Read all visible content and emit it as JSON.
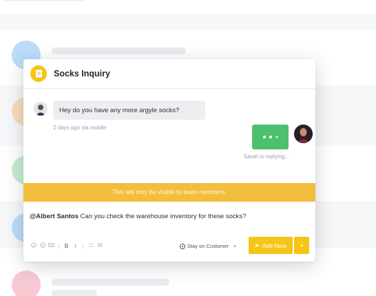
{
  "colors": {
    "accent": "#f5c518",
    "notice_bg": "#f3bd3d",
    "typing_green": "#4dc06d",
    "avatar_blue": "#bcdcfb",
    "avatar_orange": "#f9dbbd",
    "avatar_green": "#c8ebd0",
    "avatar_pink": "#f8c9d3"
  },
  "conversation": {
    "title": "Socks Inquiry",
    "header_icon": "note-icon",
    "incoming": {
      "text": "Hey do you have any more argyle socks?",
      "meta": "2 days ago via mobile"
    },
    "typing": {
      "status": "Sarah is replying..."
    }
  },
  "notice": "This will only be visible to team members.",
  "composer": {
    "mention": "@Albert Santos",
    "text": " Can you check the warehouse inventory for these socks?",
    "toolbar_icons": [
      "emoji-icon",
      "video-icon",
      "gif-icon",
      "bold-icon",
      "italic-icon",
      "ordered-list-icon",
      "bullet-list-icon"
    ],
    "bold_glyph": "B",
    "italic_glyph": "I",
    "stay_option": "Stay on Customer",
    "add_note_label": "Add Note"
  }
}
